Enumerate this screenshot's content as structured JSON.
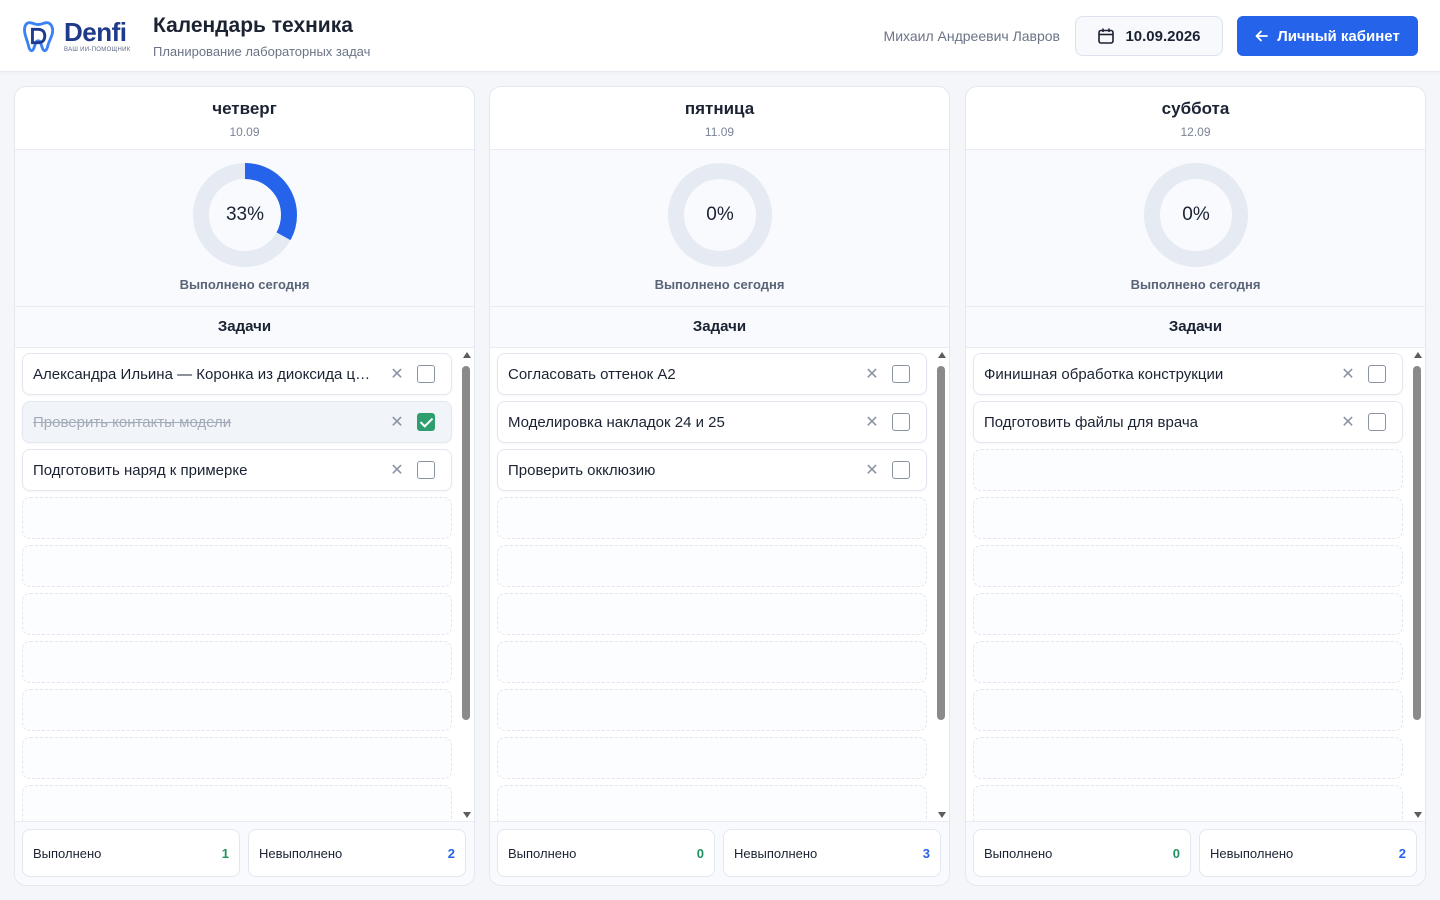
{
  "header": {
    "logo_word": "Denfi",
    "logo_tagline": "ВАШ ИИ-ПОМОЩНИК",
    "title": "Календарь техника",
    "subtitle": "Планирование лабораторных задач",
    "user_name": "Михаил Андреевич Лавров",
    "date": "10.09.2026",
    "cabinet_label": "Личный кабинет"
  },
  "labels": {
    "done_today": "Выполнено сегодня",
    "tasks": "Задачи",
    "done": "Выполнено",
    "not_done": "Невыполнено"
  },
  "colors": {
    "accent": "#2563eb",
    "done_green": "#2f9e6f",
    "ring_track": "#e6ebf3"
  },
  "icons": {
    "date": "calendar-icon",
    "cabinet": "arrow-left-icon",
    "delete": "close-icon",
    "check": "checkbox"
  },
  "days": [
    {
      "name": "четверг",
      "date": "10.09",
      "progress_text": "33%",
      "progress": 0.33,
      "tasks": [
        {
          "text": "Александра Ильина — Коронка из диоксида циркония",
          "done": false
        },
        {
          "text": "Проверить контакты модели",
          "done": true
        },
        {
          "text": "Подготовить наряд к примерке",
          "done": false
        }
      ],
      "done_count": "1",
      "not_done_count": "2"
    },
    {
      "name": "пятница",
      "date": "11.09",
      "progress_text": "0%",
      "progress": 0,
      "tasks": [
        {
          "text": "Согласовать оттенок A2",
          "done": false
        },
        {
          "text": "Моделировка накладок 24 и 25",
          "done": false
        },
        {
          "text": "Проверить окклюзию",
          "done": false
        }
      ],
      "done_count": "0",
      "not_done_count": "3"
    },
    {
      "name": "суббота",
      "date": "12.09",
      "progress_text": "0%",
      "progress": 0,
      "tasks": [
        {
          "text": "Финишная обработка конструкции",
          "done": false
        },
        {
          "text": "Подготовить файлы для врача",
          "done": false
        }
      ],
      "done_count": "0",
      "not_done_count": "2"
    }
  ]
}
